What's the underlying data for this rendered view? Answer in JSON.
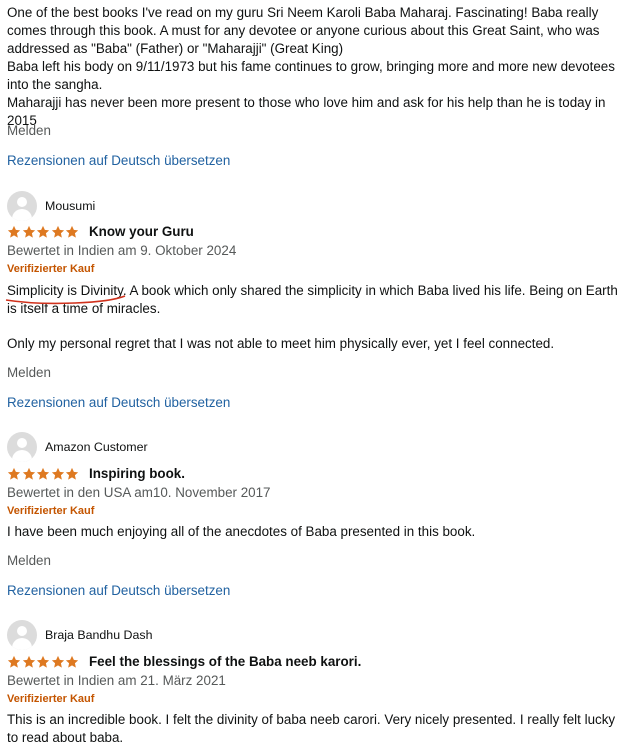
{
  "top_review": {
    "lines": [
      "One of the best books I've read on my guru Sri Neem Karoli Baba Maharaj. Fascinating! Baba really comes through this book. A must for any devotee or anyone curious about this Great Saint, who was addressed as \"Baba\" (Father) or \"Maharajji\" (Great King)",
      "Baba left his body on 9/11/1973 but his fame continues to grow, bringing more and more new devotees into the sangha.",
      "Maharajji has never been more present to those who love him and ask for his help than he is today in 2015"
    ],
    "report_label": "Melden",
    "translate_label": "Rezensionen auf Deutsch übersetzen"
  },
  "reviews": [
    {
      "reviewer": "Mousumi",
      "rating": 5,
      "title": "Know your Guru",
      "meta": "Bewertet in Indien am 9. Oktober 2024",
      "verified": "Verifizierter Kauf",
      "highlight": "Simplicity is Divinity.",
      "body_rest": " A book which only shared the simplicity in which Baba lived his life. Being on Earth is itself a time of miracles.",
      "body_second": "Only my personal regret that I was not able to meet him physically ever, yet I feel connected.",
      "report_label": "Melden",
      "translate_label": "Rezensionen auf Deutsch übersetzen"
    },
    {
      "reviewer": "Amazon Customer",
      "rating": 5,
      "title": "Inspiring book.",
      "meta": "Bewertet in den USA am10. November 2017",
      "verified": "Verifizierter Kauf",
      "body": "I have been much enjoying all of the anecdotes of Baba presented in this book.",
      "report_label": "Melden",
      "translate_label": "Rezensionen auf Deutsch übersetzen"
    },
    {
      "reviewer": "Braja Bandhu Dash",
      "rating": 5,
      "title": "Feel the blessings of the Baba neeb karori.",
      "meta": "Bewertet in Indien am 21. März 2021",
      "verified": "Verifizierter Kauf",
      "body": "This is an incredible book. I felt the divinity of baba neeb carori. Very nicely presented. I really felt lucky to read about baba."
    }
  ],
  "colors": {
    "link": "#2162a1",
    "verified": "#c45500",
    "star": "#de7921",
    "muted": "#565959",
    "highlight_underline": "#d0311c"
  },
  "icons": {
    "avatar": "default-user-avatar-icon",
    "star": "star-filled-icon"
  }
}
